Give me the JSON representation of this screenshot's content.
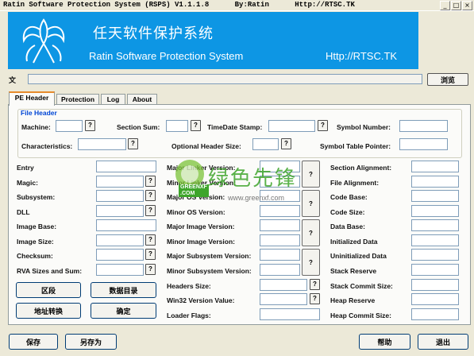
{
  "title": "Ratin Software Protection System (RSPS) V1.1.1.8      By:Ratin      Http://RTSC.TK",
  "window_buttons": {
    "minimize": "_",
    "maximize": "□",
    "close": "×"
  },
  "banner": {
    "cn": "任天软件保护系统",
    "en": "Ratin Software Protection System",
    "url": "Http://RTSC.TK"
  },
  "file_row": {
    "label": "文",
    "browse": "浏览"
  },
  "tabs": [
    "PE Header",
    "Protection",
    "Log",
    "About"
  ],
  "file_header": {
    "title": "File Header",
    "machine": "Machine:",
    "section_sum": "Section Sum:",
    "timedate": "TimeDate Stamp:",
    "symbol_number": "Symbol Number:",
    "characteristics": "Characteristics:",
    "opt_header_size": "Optional Header Size:",
    "symbol_table_ptr": "Symbol Table Pointer:"
  },
  "left_col": [
    "Entry",
    "Magic:",
    "Subsystem:",
    "DLL",
    "Image Base:",
    "Image Size:",
    "Checksum:",
    "RVA Sizes and Sum:"
  ],
  "mid_col": [
    "Major Linker Version:",
    "Minor Linker Version:",
    "Major OS Version:",
    "Minor OS Version:",
    "Major Image Version:",
    "Minor Image Version:",
    "Major Subsystem Version:",
    "Minor Subsystem Version:",
    "Headers Size:",
    "Win32 Version Value:",
    "Loader Flags:"
  ],
  "right_col": [
    "Section Alignment:",
    "File Alignment:",
    "Code Base:",
    "Code Size:",
    "Data Base:",
    "Initialized Data",
    "Uninitialized Data",
    "Stack Reserve",
    "Stack Commit Size:",
    "Heap Reserve",
    "Heap Commit Size:"
  ],
  "left_buttons": {
    "section": "区段",
    "data_dir": "数据目录",
    "addr_conv": "地址转换",
    "ok": "确定"
  },
  "question": "?",
  "watermark": {
    "brand": "绿色先锋",
    "small": "GREENXF .COM",
    "url": "www.greenxf.com"
  },
  "bottom": {
    "save": "保存",
    "save_as": "另存为",
    "help": "帮助",
    "exit": "退出"
  }
}
